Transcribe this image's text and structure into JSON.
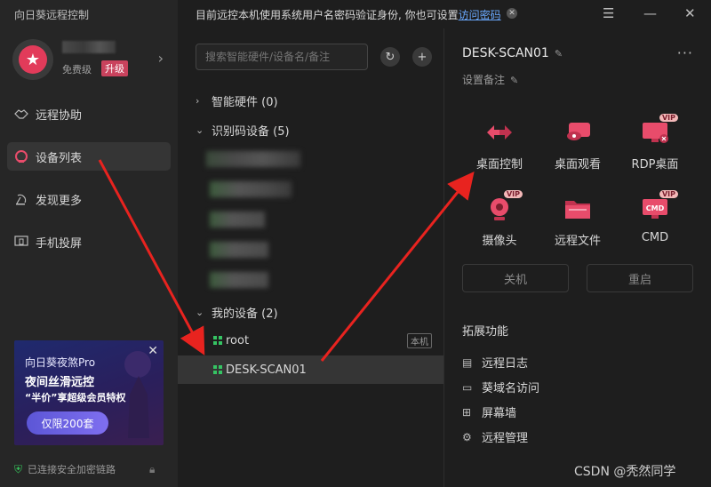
{
  "app": {
    "title": "向日葵远程控制"
  },
  "profile": {
    "plan": "免费级",
    "upgrade": "升级"
  },
  "nav": [
    {
      "label": "远程协助",
      "icon": "handshake-icon"
    },
    {
      "label": "设备列表",
      "icon": "device-list-icon"
    },
    {
      "label": "发现更多",
      "icon": "discover-icon"
    },
    {
      "label": "手机投屏",
      "icon": "screen-cast-icon"
    }
  ],
  "promo": {
    "line1": "向日葵夜煞Pro",
    "line2": "夜间丝滑远控",
    "line3": "“半价”享超级会员特权",
    "button": "仅限200套"
  },
  "status": {
    "text": "已连接安全加密链路"
  },
  "notice": {
    "text": "目前远控本机使用系统用户名密码验证身份, 你也可设置",
    "link": "访问密码"
  },
  "search": {
    "placeholder": "搜索智能硬件/设备名/备注"
  },
  "groups": {
    "smart": "智能硬件 (0)",
    "idcode": "识别码设备 (5)",
    "mine": "我的设备 (2)"
  },
  "devices": [
    {
      "name": "root",
      "badge": "本机"
    },
    {
      "name": "DESK-SCAN01"
    }
  ],
  "detail": {
    "title": "DESK-SCAN01",
    "remark": "设置备注",
    "actions": [
      {
        "label": "桌面控制",
        "icon": "desktop-control-icon",
        "vip": ""
      },
      {
        "label": "桌面观看",
        "icon": "desktop-view-icon",
        "vip": ""
      },
      {
        "label": "RDP桌面",
        "icon": "rdp-desktop-icon",
        "vip": "VIP"
      },
      {
        "label": "摄像头",
        "icon": "camera-icon",
        "vip": "VIP"
      },
      {
        "label": "远程文件",
        "icon": "folder-icon",
        "vip": ""
      },
      {
        "label": "CMD",
        "icon": "cmd-icon",
        "vip": "VIP"
      }
    ],
    "shutdown": "关机",
    "restart": "重启",
    "ext_title": "拓展功能",
    "ext_items": [
      {
        "label": "远程日志",
        "icon": "log-icon"
      },
      {
        "label": "葵域名访问",
        "icon": "domain-icon"
      },
      {
        "label": "屏幕墙",
        "icon": "screen-wall-icon"
      },
      {
        "label": "远程管理",
        "icon": "gear-icon"
      }
    ],
    "cmd_text": "CMD"
  },
  "watermark": "CSDN @秃然同学",
  "colors": {
    "accent": "#e84c6b",
    "green": "#35c463",
    "arrow": "#e8231f",
    "link": "#6aa9ff"
  }
}
